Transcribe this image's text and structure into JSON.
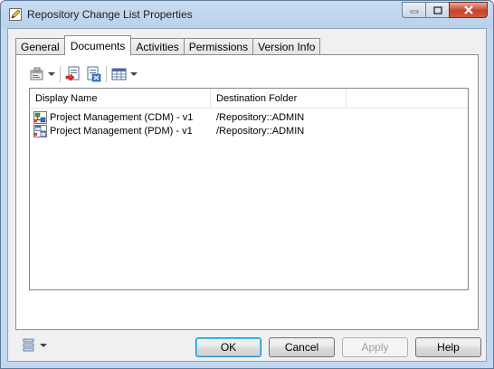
{
  "window": {
    "title": "Repository Change List Properties",
    "icon": "pencil-edit-icon"
  },
  "tabs": [
    {
      "label": "General",
      "active": false
    },
    {
      "label": "Documents",
      "active": true
    },
    {
      "label": "Activities",
      "active": false
    },
    {
      "label": "Permissions",
      "active": false
    },
    {
      "label": "Version Info",
      "active": false
    }
  ],
  "toolbar": {
    "buttons": [
      "properties-icon",
      "add-documents-icon",
      "remove-documents-icon",
      "customize-columns-icon"
    ]
  },
  "list": {
    "columns": [
      "Display Name",
      "Destination Folder"
    ],
    "rows": [
      {
        "name": "Project Management (CDM) - v1",
        "destination": "/Repository::ADMIN",
        "icon": "cdm-model-icon"
      },
      {
        "name": "Project Management (PDM) - v1",
        "destination": "/Repository::ADMIN",
        "icon": "pdm-model-icon"
      }
    ]
  },
  "footer": {
    "more_icon": "more-options-icon",
    "ok_label": "OK",
    "cancel_label": "Cancel",
    "apply_label": "Apply",
    "apply_enabled": false,
    "help_label": "Help"
  },
  "colors": {
    "title_bar": "#b9d1ea",
    "dialog_bg": "#f0f0f0",
    "close_button": "#c7432a"
  }
}
